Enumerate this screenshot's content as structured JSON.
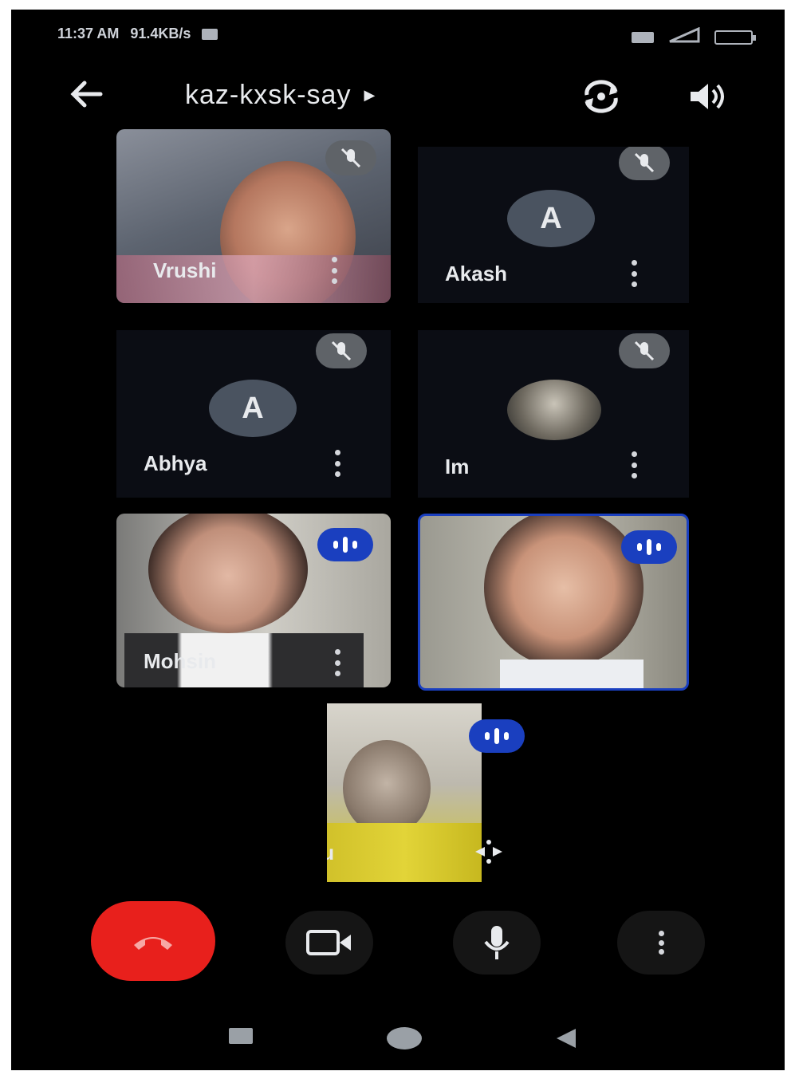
{
  "status_bar": {
    "time": "11:37 AM",
    "speed": "91.4KB/s"
  },
  "header": {
    "meeting_code": "kaz-kxsk-say"
  },
  "participants": [
    {
      "name": "Vrushi",
      "type": "video",
      "muted": true
    },
    {
      "name": "Akash",
      "type": "avatar",
      "initial": "A",
      "muted": true
    },
    {
      "name": "Abhya",
      "type": "avatar",
      "initial": "A",
      "muted": true
    },
    {
      "name": "Im",
      "type": "photo-avatar",
      "muted": true
    },
    {
      "name": "Mohsin",
      "type": "video",
      "speaking": true
    },
    {
      "name": "",
      "type": "video",
      "speaking": true,
      "active": true
    },
    {
      "name": "You",
      "type": "video",
      "speaking": true
    }
  ],
  "colors": {
    "end_call": "#e8201c",
    "speaking": "#1a3fbf",
    "background": "#000000"
  }
}
